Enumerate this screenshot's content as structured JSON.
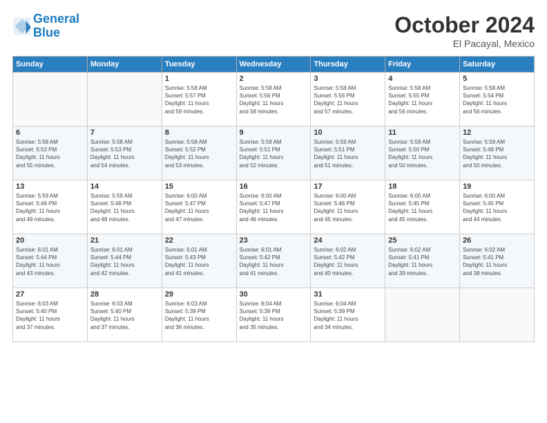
{
  "header": {
    "logo_line1": "General",
    "logo_line2": "Blue",
    "month": "October 2024",
    "location": "El Pacayal, Mexico"
  },
  "days_of_week": [
    "Sunday",
    "Monday",
    "Tuesday",
    "Wednesday",
    "Thursday",
    "Friday",
    "Saturday"
  ],
  "weeks": [
    [
      {
        "day": "",
        "info": ""
      },
      {
        "day": "",
        "info": ""
      },
      {
        "day": "1",
        "info": "Sunrise: 5:58 AM\nSunset: 5:57 PM\nDaylight: 11 hours\nand 59 minutes."
      },
      {
        "day": "2",
        "info": "Sunrise: 5:58 AM\nSunset: 5:56 PM\nDaylight: 11 hours\nand 58 minutes."
      },
      {
        "day": "3",
        "info": "Sunrise: 5:58 AM\nSunset: 5:56 PM\nDaylight: 11 hours\nand 57 minutes."
      },
      {
        "day": "4",
        "info": "Sunrise: 5:58 AM\nSunset: 5:55 PM\nDaylight: 11 hours\nand 56 minutes."
      },
      {
        "day": "5",
        "info": "Sunrise: 5:58 AM\nSunset: 5:54 PM\nDaylight: 11 hours\nand 56 minutes."
      }
    ],
    [
      {
        "day": "6",
        "info": "Sunrise: 5:58 AM\nSunset: 5:53 PM\nDaylight: 11 hours\nand 55 minutes."
      },
      {
        "day": "7",
        "info": "Sunrise: 5:58 AM\nSunset: 5:53 PM\nDaylight: 11 hours\nand 54 minutes."
      },
      {
        "day": "8",
        "info": "Sunrise: 5:58 AM\nSunset: 5:52 PM\nDaylight: 11 hours\nand 53 minutes."
      },
      {
        "day": "9",
        "info": "Sunrise: 5:59 AM\nSunset: 5:51 PM\nDaylight: 11 hours\nand 52 minutes."
      },
      {
        "day": "10",
        "info": "Sunrise: 5:59 AM\nSunset: 5:51 PM\nDaylight: 11 hours\nand 51 minutes."
      },
      {
        "day": "11",
        "info": "Sunrise: 5:59 AM\nSunset: 5:50 PM\nDaylight: 11 hours\nand 50 minutes."
      },
      {
        "day": "12",
        "info": "Sunrise: 5:59 AM\nSunset: 5:49 PM\nDaylight: 11 hours\nand 50 minutes."
      }
    ],
    [
      {
        "day": "13",
        "info": "Sunrise: 5:59 AM\nSunset: 5:49 PM\nDaylight: 11 hours\nand 49 minutes."
      },
      {
        "day": "14",
        "info": "Sunrise: 5:59 AM\nSunset: 5:48 PM\nDaylight: 11 hours\nand 48 minutes."
      },
      {
        "day": "15",
        "info": "Sunrise: 6:00 AM\nSunset: 5:47 PM\nDaylight: 11 hours\nand 47 minutes."
      },
      {
        "day": "16",
        "info": "Sunrise: 6:00 AM\nSunset: 5:47 PM\nDaylight: 11 hours\nand 46 minutes."
      },
      {
        "day": "17",
        "info": "Sunrise: 6:00 AM\nSunset: 5:46 PM\nDaylight: 11 hours\nand 45 minutes."
      },
      {
        "day": "18",
        "info": "Sunrise: 6:00 AM\nSunset: 5:45 PM\nDaylight: 11 hours\nand 45 minutes."
      },
      {
        "day": "19",
        "info": "Sunrise: 6:00 AM\nSunset: 5:45 PM\nDaylight: 11 hours\nand 44 minutes."
      }
    ],
    [
      {
        "day": "20",
        "info": "Sunrise: 6:01 AM\nSunset: 5:44 PM\nDaylight: 11 hours\nand 43 minutes."
      },
      {
        "day": "21",
        "info": "Sunrise: 6:01 AM\nSunset: 5:44 PM\nDaylight: 11 hours\nand 42 minutes."
      },
      {
        "day": "22",
        "info": "Sunrise: 6:01 AM\nSunset: 5:43 PM\nDaylight: 11 hours\nand 41 minutes."
      },
      {
        "day": "23",
        "info": "Sunrise: 6:01 AM\nSunset: 5:42 PM\nDaylight: 11 hours\nand 41 minutes."
      },
      {
        "day": "24",
        "info": "Sunrise: 6:02 AM\nSunset: 5:42 PM\nDaylight: 11 hours\nand 40 minutes."
      },
      {
        "day": "25",
        "info": "Sunrise: 6:02 AM\nSunset: 5:41 PM\nDaylight: 11 hours\nand 39 minutes."
      },
      {
        "day": "26",
        "info": "Sunrise: 6:02 AM\nSunset: 5:41 PM\nDaylight: 11 hours\nand 38 minutes."
      }
    ],
    [
      {
        "day": "27",
        "info": "Sunrise: 6:03 AM\nSunset: 5:40 PM\nDaylight: 11 hours\nand 37 minutes."
      },
      {
        "day": "28",
        "info": "Sunrise: 6:03 AM\nSunset: 5:40 PM\nDaylight: 11 hours\nand 37 minutes."
      },
      {
        "day": "29",
        "info": "Sunrise: 6:03 AM\nSunset: 5:39 PM\nDaylight: 11 hours\nand 36 minutes."
      },
      {
        "day": "30",
        "info": "Sunrise: 6:04 AM\nSunset: 5:39 PM\nDaylight: 11 hours\nand 35 minutes."
      },
      {
        "day": "31",
        "info": "Sunrise: 6:04 AM\nSunset: 5:39 PM\nDaylight: 11 hours\nand 34 minutes."
      },
      {
        "day": "",
        "info": ""
      },
      {
        "day": "",
        "info": ""
      }
    ]
  ]
}
